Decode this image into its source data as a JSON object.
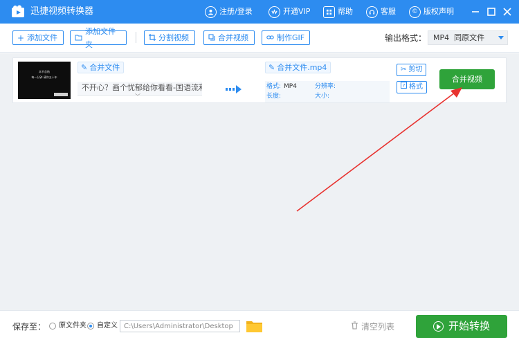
{
  "app": {
    "title": "迅捷视频转换器"
  },
  "titlebar": {
    "register_login": "注册/登录",
    "vip": "开通VIP",
    "help": "帮助",
    "service": "客服",
    "copyright": "版权声明"
  },
  "toolbar": {
    "add_file": "添加文件",
    "add_folder": "添加文件夹",
    "split_video": "分割视频",
    "merge_video": "合并视频",
    "make_gif": "制作GIF",
    "output_format_label": "输出格式：",
    "output_format_value": "MP4  同原文件"
  },
  "file_item": {
    "thumbnail_line1": "本节总结",
    "thumbnail_line2": "每一分钟  请你五十年",
    "source_tag": "合并文件",
    "source_name": "不开心？画个忧郁给你看看-国语流利",
    "target_tag": "合并文件.mp4",
    "format_key": "格式:",
    "format_value": "MP4",
    "resolution_key": "分辨率:",
    "duration_key": "长度:",
    "size_key": "大小:",
    "cut_label": "剪切",
    "format_label": "格式",
    "merge_button": "合并视频"
  },
  "footer": {
    "save_to": "保存至：",
    "option_original": "原文件夹",
    "option_custom": "自定义",
    "path": "C:\\Users\\Administrator\\Desktop",
    "clear_list": "清空列表",
    "start": "开始转换"
  },
  "colors": {
    "brand_blue": "#2d8cf0",
    "green": "#2fa33a",
    "annotation_red": "#e8322f"
  }
}
